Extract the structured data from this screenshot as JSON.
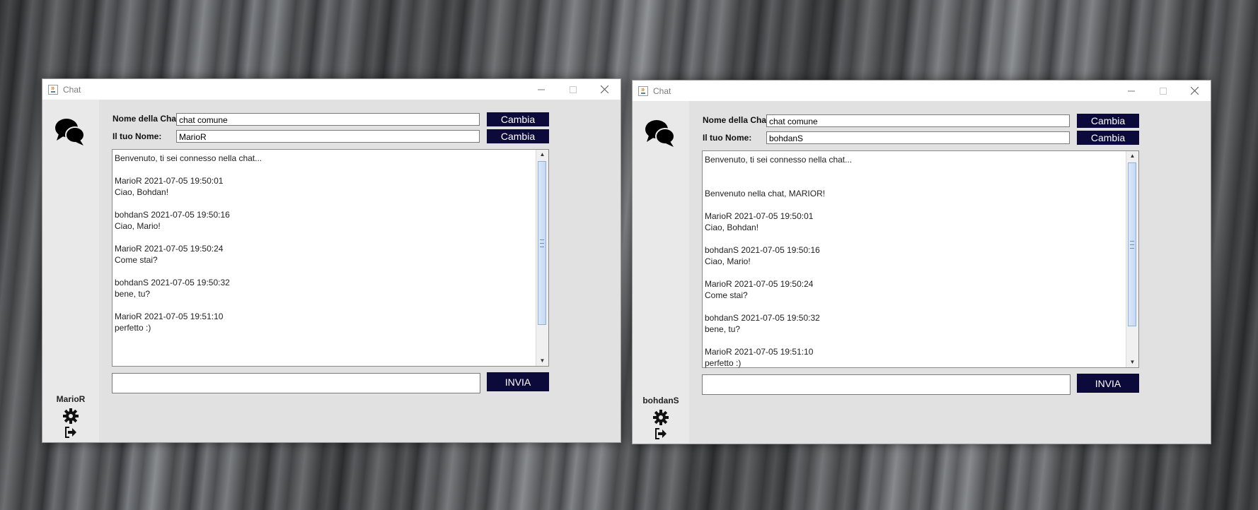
{
  "windows": [
    {
      "title": "Chat",
      "chat_name_label": "Nome della Chat:",
      "chat_name_value": "chat comune",
      "your_name_label": "Il tuo Nome:",
      "your_name_value": "MarioR",
      "change_button": "Cambia",
      "send_button": "INVIA",
      "username": "MarioR",
      "message_input_value": "",
      "messages": [
        "Benvenuto, ti sei connesso nella chat...",
        "",
        "MarioR 2021-07-05 19:50:01",
        "Ciao, Bohdan!",
        "",
        "bohdanS 2021-07-05 19:50:16",
        "Ciao, Mario!",
        "",
        "MarioR 2021-07-05 19:50:24",
        "Come stai?",
        "",
        "bohdanS 2021-07-05 19:50:32",
        "bene, tu?",
        "",
        "MarioR 2021-07-05 19:51:10",
        "perfetto :)"
      ]
    },
    {
      "title": "Chat",
      "chat_name_label": "Nome della Chat:",
      "chat_name_value": "chat comune",
      "your_name_label": "Il tuo Nome:",
      "your_name_value": "bohdanS",
      "change_button": "Cambia",
      "send_button": "INVIA",
      "username": "bohdanS",
      "message_input_value": "",
      "messages": [
        "Benvenuto, ti sei connesso nella chat...",
        "",
        "",
        "Benvenuto nella chat, MARIOR!",
        "",
        "MarioR 2021-07-05 19:50:01",
        "Ciao, Bohdan!",
        "",
        "bohdanS 2021-07-05 19:50:16",
        "Ciao, Mario!",
        "",
        "MarioR 2021-07-05 19:50:24",
        "Come stai?",
        "",
        "bohdanS 2021-07-05 19:50:32",
        "bene, tu?",
        "",
        "MarioR 2021-07-05 19:51:10",
        "perfetto :)"
      ]
    }
  ],
  "icons": {
    "logo": "chat-bubbles-icon",
    "settings": "gear-icon",
    "logout": "sign-out-icon",
    "minimize": "minimize-icon",
    "maximize": "maximize-icon",
    "close": "close-icon",
    "app": "java-icon"
  },
  "colors": {
    "button_bg": "#0b0a3a",
    "content_bg": "#e1e1e1",
    "sidebar_bg": "#e9e9e9"
  }
}
